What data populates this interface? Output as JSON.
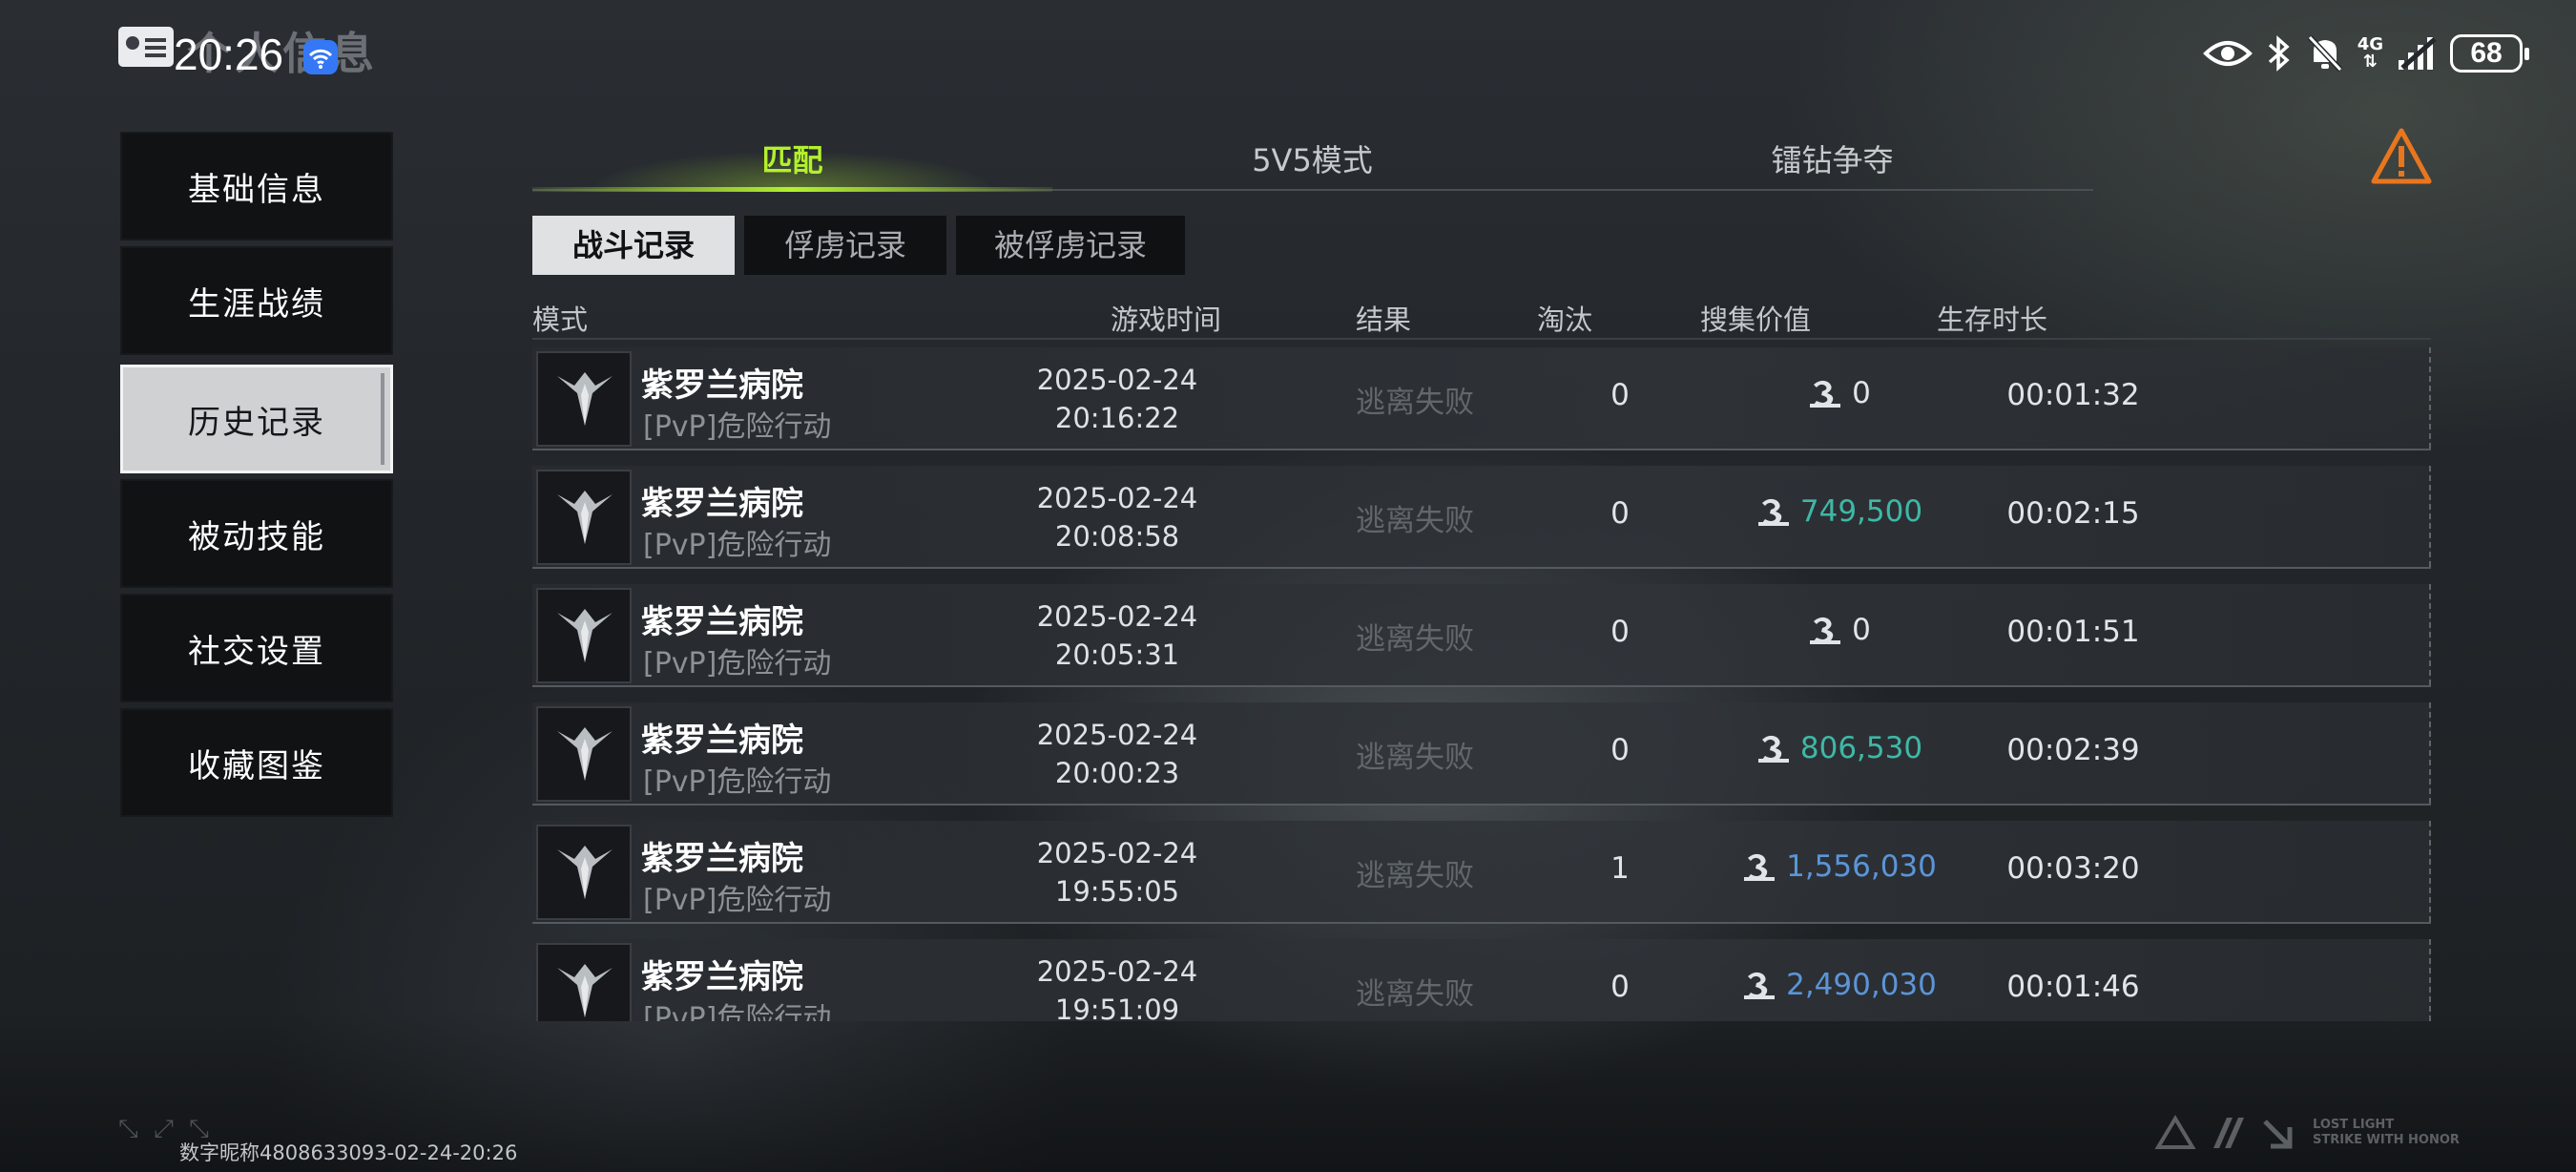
{
  "status_bar": {
    "time": "20:26",
    "battery": "68",
    "network": "4G",
    "header_title": "个人信息"
  },
  "sidebar": {
    "items": [
      {
        "label": "基础信息",
        "active": false
      },
      {
        "label": "生涯战绩",
        "active": false
      },
      {
        "label": "历史记录",
        "active": true
      },
      {
        "label": "被动技能",
        "active": false
      },
      {
        "label": "社交设置",
        "active": false
      },
      {
        "label": "收藏图鉴",
        "active": false
      }
    ]
  },
  "top_tabs": [
    {
      "label": "匹配",
      "active": true
    },
    {
      "label": "5V5模式",
      "active": false
    },
    {
      "label": "镭钻争夺",
      "active": false
    }
  ],
  "sub_tabs": [
    {
      "label": "战斗记录",
      "active": true
    },
    {
      "label": "俘虏记录",
      "active": false
    },
    {
      "label": "被俘虏记录",
      "active": false
    }
  ],
  "table": {
    "headers": {
      "mode": "模式",
      "time": "游戏时间",
      "result": "结果",
      "kills": "淘汰",
      "value": "搜集价值",
      "survive": "生存时长"
    },
    "rows": [
      {
        "map": "紫罗兰病院",
        "mode": "[PvP]危险行动",
        "date": "2025-02-24",
        "clock": "20:16:22",
        "result": "逃离失败",
        "kills": "0",
        "value": "0",
        "value_color": "#e2e5e8",
        "survive": "00:01:32"
      },
      {
        "map": "紫罗兰病院",
        "mode": "[PvP]危险行动",
        "date": "2025-02-24",
        "clock": "20:08:58",
        "result": "逃离失败",
        "kills": "0",
        "value": "749,500",
        "value_color": "#3fb8a6",
        "survive": "00:02:15"
      },
      {
        "map": "紫罗兰病院",
        "mode": "[PvP]危险行动",
        "date": "2025-02-24",
        "clock": "20:05:31",
        "result": "逃离失败",
        "kills": "0",
        "value": "0",
        "value_color": "#e2e5e8",
        "survive": "00:01:51"
      },
      {
        "map": "紫罗兰病院",
        "mode": "[PvP]危险行动",
        "date": "2025-02-24",
        "clock": "20:00:23",
        "result": "逃离失败",
        "kills": "0",
        "value": "806,530",
        "value_color": "#3fb8a6",
        "survive": "00:02:39"
      },
      {
        "map": "紫罗兰病院",
        "mode": "[PvP]危险行动",
        "date": "2025-02-24",
        "clock": "19:55:05",
        "result": "逃离失败",
        "kills": "1",
        "value": "1,556,030",
        "value_color": "#5b95d8",
        "survive": "00:03:20"
      },
      {
        "map": "紫罗兰病院",
        "mode": "[PvP]危险行动",
        "date": "2025-02-24",
        "clock": "19:51:09",
        "result": "逃离失败",
        "kills": "0",
        "value": "2,490,030",
        "value_color": "#5b95d8",
        "survive": "00:01:46"
      }
    ]
  },
  "footer": {
    "player_id": "数字昵称4808633093-02-24-20:26",
    "slogan_line1": "LOST LIGHT",
    "slogan_line2": "STRIKE WITH HONOR"
  },
  "colors": {
    "accent": "#b3f02e",
    "warning": "#e8761f"
  }
}
